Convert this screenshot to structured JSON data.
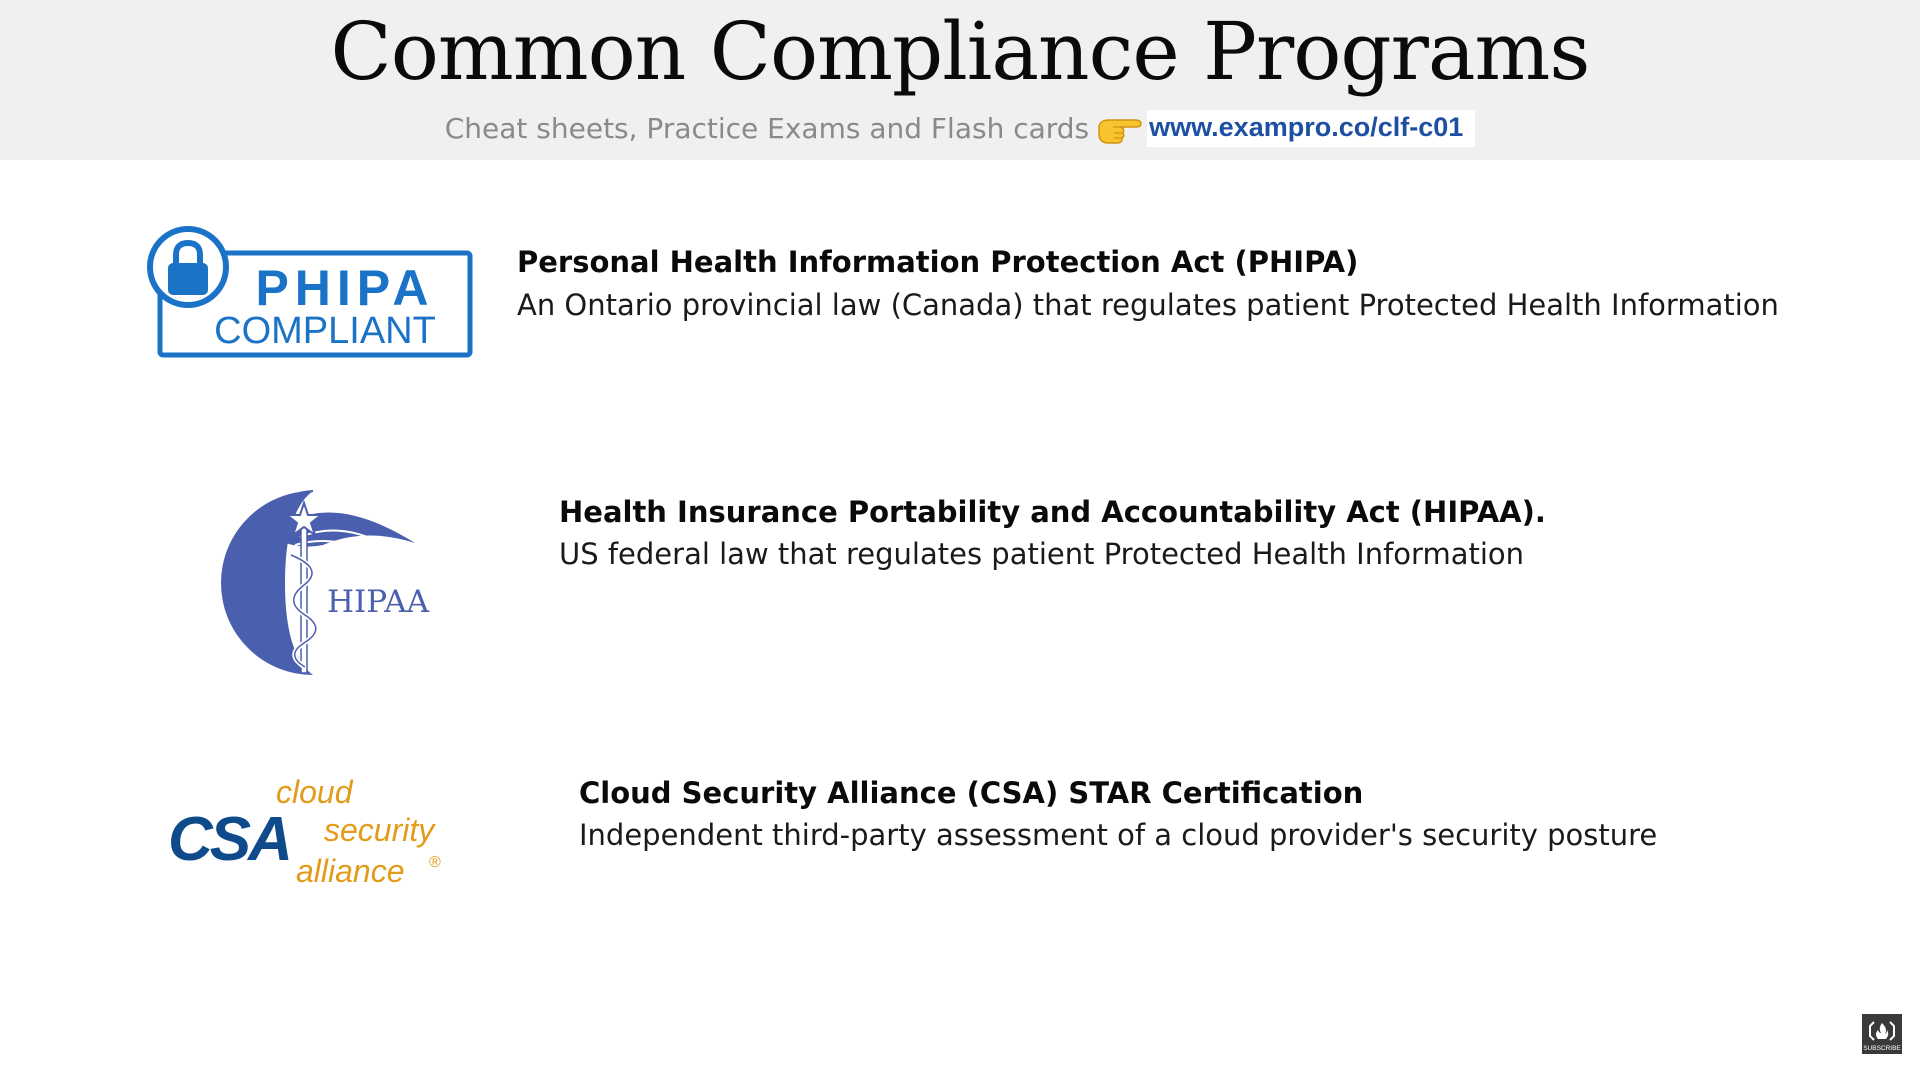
{
  "header": {
    "title": "Common Compliance Programs",
    "subtitle": "Cheat sheets, Practice Exams and Flash cards",
    "hand_icon": "pointing-hand-icon",
    "url": "www.exampro.co/clf-c01"
  },
  "programs": [
    {
      "title": "Personal Health Information Protection Act (PHIPA)",
      "description": "An Ontario provincial law (Canada) that regulates patient Protected Health Information",
      "logo": {
        "line1": "PHIPA",
        "line2": "COMPLIANT",
        "color": "#1a73c7"
      }
    },
    {
      "title": "Health Insurance Portability and Accountability Act (HIPAA).",
      "description": "US federal law that regulates patient Protected Health Information",
      "logo": {
        "text": "HIPAA",
        "color": "#4a5fae"
      }
    },
    {
      "title": "Cloud Security Alliance (CSA) STAR Certification",
      "description": "Independent third-party assessment of a cloud provider's security posture",
      "logo": {
        "acronym": "CSA",
        "word1": "cloud",
        "word2": "security",
        "word3": "alliance",
        "mark": "®",
        "acronym_color": "#0f4a8a",
        "word_color": "#e39b1a"
      }
    }
  ],
  "badge": {
    "text": "SUBSCRIBE"
  }
}
